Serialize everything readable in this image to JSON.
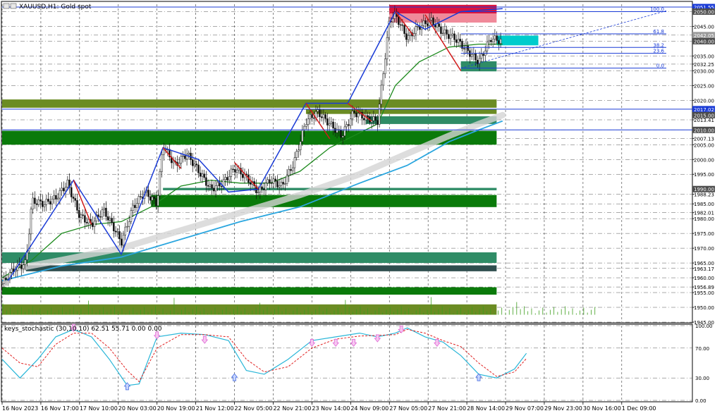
{
  "header": {
    "title": "XAUUSD,H1:  Gold spot"
  },
  "indicator": {
    "title": "keys_stochastic (30,10,10) 62.51 55.71 0.00 0.00"
  },
  "colors": {
    "bull": "#1a3bd6",
    "bear": "#d11a1a",
    "green_zone": "#0a7a0a",
    "teal_zone": "#2f8c66",
    "dark_zone": "#2e4e4e",
    "volume": "#6b8c23",
    "ma_fast": "#1d8a1d",
    "ma_slow": "#2aa6df",
    "ribbon": "#d4d4d4",
    "supply": "#dc143c",
    "demand_cyan": "#00cccc",
    "stoch_main": "#29b6d8",
    "stoch_signal": "#e02020",
    "arrow_up": "#4a6fe0",
    "arrow_down": "#e066d6"
  },
  "chart_data": [
    {
      "type": "candlestick",
      "symbol": "XAUUSD",
      "timeframe": "H1",
      "title": "XAUUSD,H1:  Gold spot",
      "ylim": [
        1945,
        2052.5
      ],
      "y_ticks": [
        "2050.00",
        "2045.00",
        "2042.05",
        "2040.00",
        "2035.00",
        "2032.25",
        "2030.00",
        "2025.00",
        "2020.00",
        "2013.41",
        "2010.00",
        "2007.13",
        "2005.00",
        "2000.00",
        "1995.00",
        "1988.23",
        "1985.00",
        "1982.01",
        "1980.00",
        "1975.00",
        "1970.00",
        "1965.00",
        "1963.17",
        "1960.00",
        "1956.89",
        "1955.00",
        "1950.00",
        "1945.00"
      ],
      "y_tick_values": [
        2050,
        2045,
        2042.05,
        2040,
        2035,
        2032.25,
        2030,
        2025,
        2020,
        2013.41,
        2010,
        2007.13,
        2005,
        2000,
        1995,
        1988.23,
        1985,
        1982.01,
        1980,
        1975,
        1970,
        1965,
        1963.17,
        1960,
        1956.89,
        1955,
        1950,
        1945
      ],
      "x_labels": [
        "16 Nov 2023",
        "16 Nov 17:00",
        "17 Nov 10:00",
        "20 Nov 03:00",
        "20 Nov 19:00",
        "21 Nov 12:00",
        "22 Nov 05:00",
        "22 Nov 21:00",
        "23 Nov 14:00",
        "24 Nov 09:00",
        "27 Nov 05:00",
        "27 Nov 21:00",
        "28 Nov 14:00",
        "29 Nov 07:00",
        "29 Nov 23:00",
        "30 Nov 16:00",
        "1 Dec 09:00"
      ],
      "price_tags": [
        {
          "value": 2051.55,
          "label": "2051.55",
          "color": "#1a3bd6"
        },
        {
          "value": 2050.0,
          "label": "2050.00",
          "color": "#4d4d4d"
        },
        {
          "value": 2042.05,
          "label": "2042.05",
          "color": "#9a9a9a"
        },
        {
          "value": 2040.0,
          "label": "2040.00",
          "color": "#4d4d4d"
        },
        {
          "value": 2017.02,
          "label": "2017.02",
          "color": "#1a3bd6"
        },
        {
          "value": 2015.0,
          "label": "2015.00",
          "color": "#4d4d4d"
        },
        {
          "value": 2010.0,
          "label": "2010.00",
          "color": "#4d4d4d"
        },
        {
          "value": 1990.0,
          "label": "1990.00",
          "color": "#4d4d4d"
        }
      ],
      "fib_levels": [
        {
          "label": "100.0",
          "value": 2050.0
        },
        {
          "label": "61.8",
          "value": 2042.5
        },
        {
          "label": "38.2",
          "value": 2037.9
        },
        {
          "label": "23.6",
          "value": 2035.9
        },
        {
          "label": "0.0",
          "value": 2030.9
        }
      ],
      "hlines": [
        2051.55,
        2017.02,
        2010.0
      ],
      "zones": [
        {
          "y1": 2020.3,
          "y2": 2017.5,
          "kind": "volume",
          "end": 0.83
        },
        {
          "y1": 2017.0,
          "y2": 2015.4,
          "kind": "volume",
          "end": 0.83,
          "start": 0.51
        },
        {
          "y1": 2014.6,
          "y2": 2012.0,
          "kind": "teal_zone",
          "end": 0.83,
          "start": 0.61
        },
        {
          "y1": 2009.7,
          "y2": 2005.0,
          "kind": "green_zone",
          "end": 0.83
        },
        {
          "y1": 1990.4,
          "y2": 1989.6,
          "kind": "teal_zone",
          "end": 0.83,
          "start": 0.27
        },
        {
          "y1": 1988.0,
          "y2": 1983.9,
          "kind": "green_zone",
          "end": 0.83,
          "start": 0.25
        },
        {
          "y1": 1968.6,
          "y2": 1965.0,
          "kind": "teal_zone",
          "end": 0.83
        },
        {
          "y1": 1964.2,
          "y2": 1962.2,
          "kind": "dark_zone",
          "end": 0.83,
          "start": 0.04
        },
        {
          "y1": 1956.8,
          "y2": 1954.3,
          "kind": "green_zone",
          "end": 0.83
        },
        {
          "y1": 1951.0,
          "y2": 1947.5,
          "kind": "volume",
          "end": 0.83
        },
        {
          "y1": 2052.3,
          "y2": 2049.4,
          "kind": "supply",
          "end": 0.83,
          "start": 0.65
        },
        {
          "y1": 2049.4,
          "y2": 2046.3,
          "kind": "supply_light",
          "end": 0.83,
          "start": 0.65
        },
        {
          "y1": 2041.9,
          "y2": 2038.6,
          "kind": "demand_cyan",
          "end": 0.9,
          "start": 0.83
        },
        {
          "y1": 2033.2,
          "y2": 2029.8,
          "kind": "teal_zone",
          "end": 0.83,
          "start": 0.77
        }
      ],
      "close_path": [
        [
          0,
          1958
        ],
        [
          0.02,
          1963
        ],
        [
          0.04,
          1965
        ],
        [
          0.05,
          1986
        ],
        [
          0.07,
          1985
        ],
        [
          0.09,
          1987
        ],
        [
          0.11,
          1992
        ],
        [
          0.13,
          1981
        ],
        [
          0.15,
          1978
        ],
        [
          0.17,
          1983
        ],
        [
          0.19,
          1976
        ],
        [
          0.2,
          1972
        ],
        [
          0.22,
          1984
        ],
        [
          0.24,
          1989
        ],
        [
          0.26,
          1985
        ],
        [
          0.27,
          2005
        ],
        [
          0.29,
          1998
        ],
        [
          0.31,
          2002
        ],
        [
          0.33,
          1996
        ],
        [
          0.35,
          1990
        ],
        [
          0.37,
          1992
        ],
        [
          0.39,
          1997
        ],
        [
          0.41,
          1994
        ],
        [
          0.43,
          1989
        ],
        [
          0.45,
          1993
        ],
        [
          0.47,
          1991
        ],
        [
          0.49,
          1999
        ],
        [
          0.51,
          2013
        ],
        [
          0.53,
          2016
        ],
        [
          0.55,
          2012
        ],
        [
          0.57,
          2008
        ],
        [
          0.59,
          2016
        ],
        [
          0.61,
          2014
        ],
        [
          0.63,
          2013
        ],
        [
          0.65,
          2047
        ],
        [
          0.66,
          2049
        ],
        [
          0.68,
          2041
        ],
        [
          0.7,
          2045
        ],
        [
          0.72,
          2047
        ],
        [
          0.74,
          2043
        ],
        [
          0.76,
          2041
        ],
        [
          0.78,
          2037
        ],
        [
          0.8,
          2033
        ],
        [
          0.82,
          2041
        ],
        [
          0.84,
          2040
        ]
      ],
      "ma_fast": [
        [
          0,
          1960
        ],
        [
          0.05,
          1966
        ],
        [
          0.1,
          1975
        ],
        [
          0.15,
          1978
        ],
        [
          0.2,
          1979
        ],
        [
          0.25,
          1984
        ],
        [
          0.3,
          1991
        ],
        [
          0.35,
          1993
        ],
        [
          0.4,
          1992
        ],
        [
          0.45,
          1992
        ],
        [
          0.5,
          1996
        ],
        [
          0.55,
          2004
        ],
        [
          0.6,
          2009
        ],
        [
          0.63,
          2012
        ],
        [
          0.66,
          2025
        ],
        [
          0.7,
          2033
        ],
        [
          0.75,
          2038
        ],
        [
          0.8,
          2039
        ],
        [
          0.84,
          2039
        ]
      ],
      "ma_slow": [
        [
          0,
          1959
        ],
        [
          0.1,
          1964
        ],
        [
          0.2,
          1967
        ],
        [
          0.3,
          1973
        ],
        [
          0.4,
          1979
        ],
        [
          0.5,
          1984
        ],
        [
          0.6,
          1992
        ],
        [
          0.68,
          1998
        ],
        [
          0.75,
          2006
        ],
        [
          0.8,
          2010
        ],
        [
          0.84,
          2013
        ]
      ],
      "ribbon": [
        [
          0.02,
          1963
        ],
        [
          0.1,
          1966
        ],
        [
          0.2,
          1970
        ],
        [
          0.3,
          1976
        ],
        [
          0.4,
          1982
        ],
        [
          0.5,
          1988
        ],
        [
          0.6,
          1995
        ],
        [
          0.68,
          2002
        ],
        [
          0.75,
          2008
        ],
        [
          0.8,
          2012
        ],
        [
          0.84,
          2015
        ]
      ],
      "zigzag_bull": [
        [
          0.01,
          1959
        ],
        [
          0.12,
          1993
        ],
        [
          0.2,
          1968
        ],
        [
          0.27,
          2004
        ],
        [
          0.33,
          2000
        ],
        [
          0.38,
          1989
        ],
        [
          0.43,
          1990
        ],
        [
          0.51,
          2019
        ],
        [
          0.58,
          2019
        ],
        [
          0.66,
          2050
        ],
        [
          0.71,
          2044
        ],
        [
          0.77,
          2050
        ],
        [
          0.84,
          2051
        ]
      ],
      "zigzag_bear": [
        [
          0.12,
          1993
        ],
        [
          0.15,
          1978
        ],
        [
          0.27,
          2004
        ],
        [
          0.3,
          1997
        ],
        [
          0.39,
          1999
        ],
        [
          0.43,
          1990
        ],
        [
          0.51,
          2019
        ],
        [
          0.55,
          2007
        ],
        [
          0.58,
          2019
        ],
        [
          0.62,
          2013
        ],
        [
          0.66,
          2050
        ],
        [
          0.69,
          2042
        ],
        [
          0.71,
          2049
        ],
        [
          0.77,
          2030
        ]
      ]
    },
    {
      "type": "line",
      "title": "keys_stochastic (30,10,10) 62.51 55.71 0.00 0.00",
      "ylim": [
        0,
        100
      ],
      "y_ticks": [
        "100.00",
        "70.00",
        "30.00",
        "0.00"
      ],
      "y_tick_values": [
        100,
        70,
        30,
        0
      ],
      "series": [
        {
          "values": [
            [
              0,
              55
            ],
            [
              0.03,
              30
            ],
            [
              0.06,
              55
            ],
            [
              0.09,
              85
            ],
            [
              0.12,
              95
            ],
            [
              0.15,
              85
            ],
            [
              0.18,
              55
            ],
            [
              0.21,
              20
            ],
            [
              0.23,
              22
            ],
            [
              0.26,
              85
            ],
            [
              0.3,
              90
            ],
            [
              0.34,
              88
            ],
            [
              0.38,
              80
            ],
            [
              0.41,
              40
            ],
            [
              0.44,
              35
            ],
            [
              0.48,
              55
            ],
            [
              0.52,
              80
            ],
            [
              0.56,
              85
            ],
            [
              0.6,
              90
            ],
            [
              0.63,
              85
            ],
            [
              0.66,
              90
            ],
            [
              0.68,
              97
            ],
            [
              0.71,
              85
            ],
            [
              0.74,
              78
            ],
            [
              0.77,
              60
            ],
            [
              0.8,
              35
            ],
            [
              0.83,
              30
            ],
            [
              0.86,
              42
            ],
            [
              0.88,
              63
            ]
          ]
        },
        {
          "values": [
            [
              0,
              70
            ],
            [
              0.03,
              50
            ],
            [
              0.06,
              45
            ],
            [
              0.09,
              75
            ],
            [
              0.12,
              90
            ],
            [
              0.15,
              90
            ],
            [
              0.18,
              70
            ],
            [
              0.21,
              40
            ],
            [
              0.23,
              25
            ],
            [
              0.26,
              70
            ],
            [
              0.3,
              88
            ],
            [
              0.34,
              88
            ],
            [
              0.38,
              85
            ],
            [
              0.41,
              55
            ],
            [
              0.44,
              38
            ],
            [
              0.48,
              45
            ],
            [
              0.52,
              70
            ],
            [
              0.56,
              82
            ],
            [
              0.6,
              86
            ],
            [
              0.63,
              87
            ],
            [
              0.66,
              88
            ],
            [
              0.68,
              95
            ],
            [
              0.71,
              90
            ],
            [
              0.74,
              80
            ],
            [
              0.77,
              72
            ],
            [
              0.8,
              50
            ],
            [
              0.83,
              32
            ],
            [
              0.86,
              38
            ],
            [
              0.88,
              56
            ]
          ]
        }
      ],
      "arrows_up": [
        [
          0.21,
          18
        ],
        [
          0.39,
          30
        ],
        [
          0.8,
          30
        ]
      ],
      "arrows_down": [
        [
          0.12,
          98
        ],
        [
          0.26,
          88
        ],
        [
          0.34,
          82
        ],
        [
          0.52,
          78
        ],
        [
          0.56,
          78
        ],
        [
          0.59,
          78
        ],
        [
          0.63,
          84
        ],
        [
          0.67,
          96
        ],
        [
          0.73,
          78
        ]
      ]
    }
  ]
}
